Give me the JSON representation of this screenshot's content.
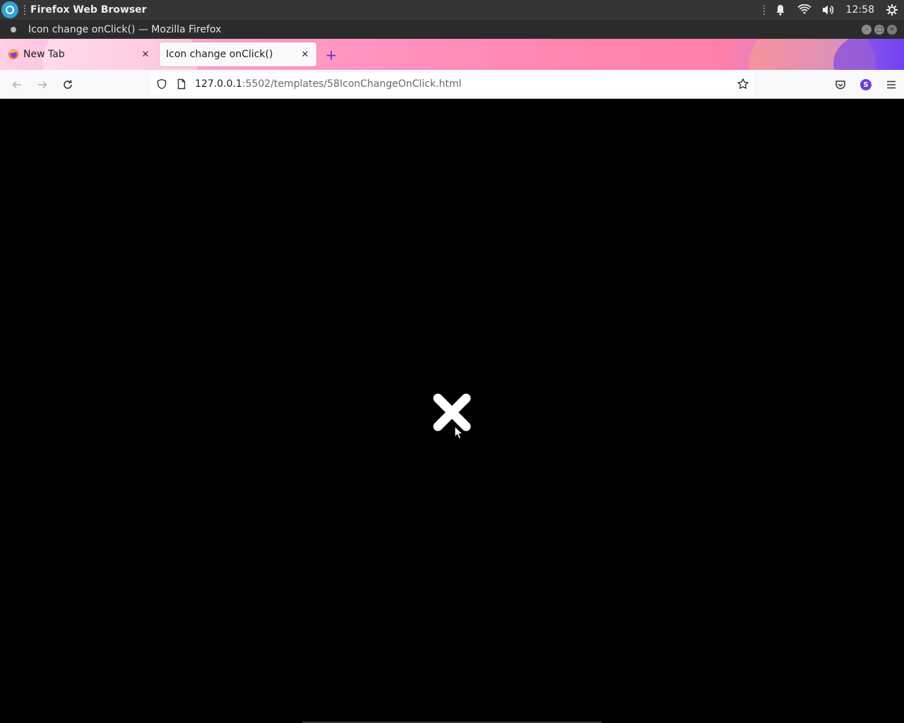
{
  "system_bar": {
    "app_name": "Firefox Web Browser",
    "clock": "12:58",
    "icons": [
      "activities-icon",
      "bell-icon",
      "wifi-icon",
      "volume-icon",
      "settings-icon"
    ]
  },
  "window": {
    "title": "Icon change onClick() — Mozilla Firefox"
  },
  "tabs": [
    {
      "label": "New Tab",
      "icon": "firefox-icon",
      "active": false
    },
    {
      "label": "Icon change onClick()",
      "active": true
    }
  ],
  "navbar": {
    "url_host": "127.0.0.1",
    "url_rest": ":5502/templates/58IconChangeOnClick.html",
    "avatar_letter": "S"
  },
  "content": {
    "background": "#000000",
    "icon": "close-icon",
    "icon_color": "#ffffff"
  },
  "colors": {
    "accent": "#5b2fd6",
    "activities": "#2fa4d9"
  }
}
